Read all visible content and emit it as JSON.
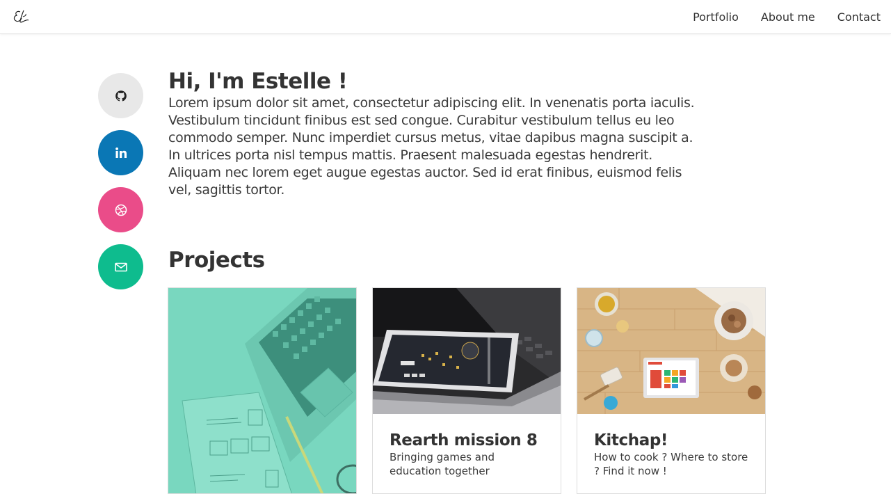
{
  "header": {
    "logo_text": "EL",
    "nav": [
      "Portfolio",
      "About me",
      "Contact"
    ]
  },
  "social": [
    {
      "name": "github",
      "color": "#e8e8e8",
      "icon_color": "#222222"
    },
    {
      "name": "linkedin",
      "color": "#0a77b5",
      "icon_color": "#ffffff"
    },
    {
      "name": "dribbble",
      "color": "#ea4c89",
      "icon_color": "#ffffff"
    },
    {
      "name": "email",
      "color": "#0ebc8e",
      "icon_color": "#ffffff"
    }
  ],
  "intro": {
    "heading": "Hi, I'm Estelle !",
    "body": "Lorem ipsum dolor sit amet, consectetur adipiscing elit. In venenatis porta iaculis. Vestibulum tincidunt finibus est sed congue. Curabitur vestibulum tellus eu leo commodo semper. Nunc imperdiet cursus metus, vitae dapibus magna suscipit a. In ultrices porta nisl tempus mattis. Praesent malesuada egestas hendrerit. Aliquam nec lorem eget augue egestas auctor. Sed id erat finibus, euismod felis vel, sagittis tortor."
  },
  "projects": {
    "title": "Projects",
    "cards": [
      {
        "title": "",
        "desc": ""
      },
      {
        "title": "Rearth mission 8",
        "desc": "Bringing games and education together"
      },
      {
        "title": "Kitchap!",
        "desc": "How to cook ? Where to store ? Find it now !"
      }
    ]
  }
}
